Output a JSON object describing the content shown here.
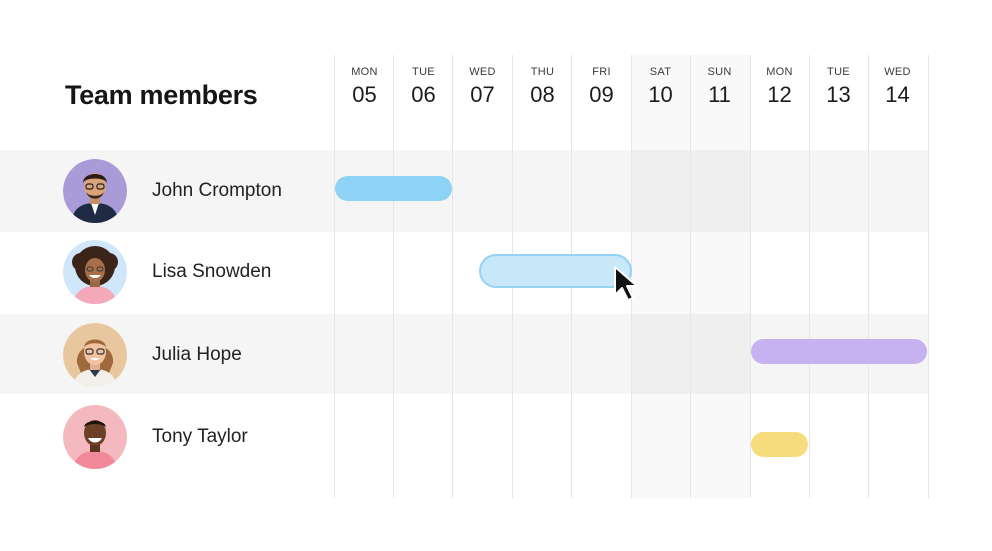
{
  "header": {
    "title": "Team members"
  },
  "days": [
    {
      "name": "MON",
      "num": "05"
    },
    {
      "name": "TUE",
      "num": "06"
    },
    {
      "name": "WED",
      "num": "07"
    },
    {
      "name": "THU",
      "num": "08"
    },
    {
      "name": "FRI",
      "num": "09"
    },
    {
      "name": "SAT",
      "num": "10"
    },
    {
      "name": "SUN",
      "num": "11"
    },
    {
      "name": "MON",
      "num": "12"
    },
    {
      "name": "TUE",
      "num": "13"
    },
    {
      "name": "WED",
      "num": "14"
    }
  ],
  "members": [
    {
      "name": "John Crompton"
    },
    {
      "name": "Lisa Snowden"
    },
    {
      "name": "Julia Hope"
    },
    {
      "name": "Tony Taylor"
    }
  ],
  "colors": {
    "bar_john": "#8ed3f5",
    "bar_lisa": "#c8e8f9",
    "bar_julia": "#c6b2f1",
    "bar_tony": "#f6dc7d"
  }
}
